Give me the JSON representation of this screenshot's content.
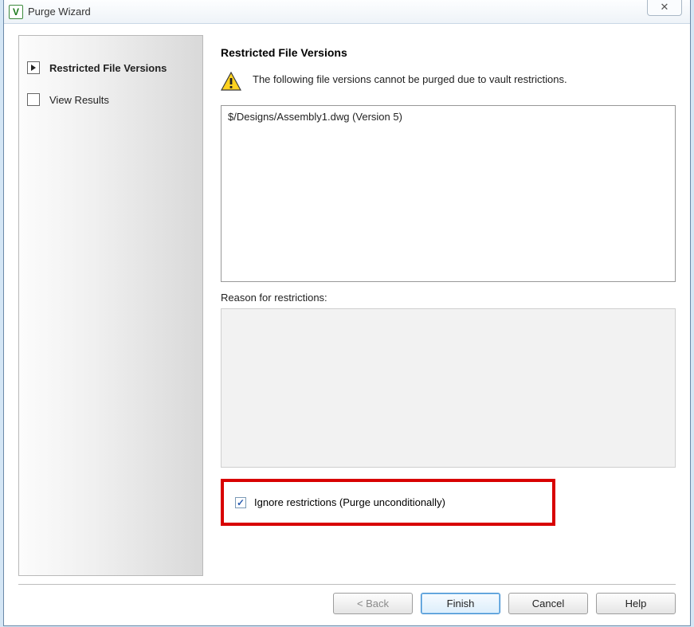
{
  "window": {
    "title": "Purge Wizard"
  },
  "sidebar": {
    "items": [
      {
        "label": "Restricted File Versions",
        "active": true
      },
      {
        "label": "View Results",
        "active": false
      }
    ]
  },
  "content": {
    "heading": "Restricted File Versions",
    "info_text": "The following file versions cannot be purged due to vault restrictions.",
    "file_list": [
      "$/Designs/Assembly1.dwg (Version 5)"
    ],
    "reason_label": "Reason for restrictions:",
    "reason_text": "",
    "ignore_label": "Ignore restrictions (Purge unconditionally)",
    "ignore_checked": true
  },
  "buttons": {
    "back": "< Back",
    "finish": "Finish",
    "cancel": "Cancel",
    "help": "Help"
  }
}
